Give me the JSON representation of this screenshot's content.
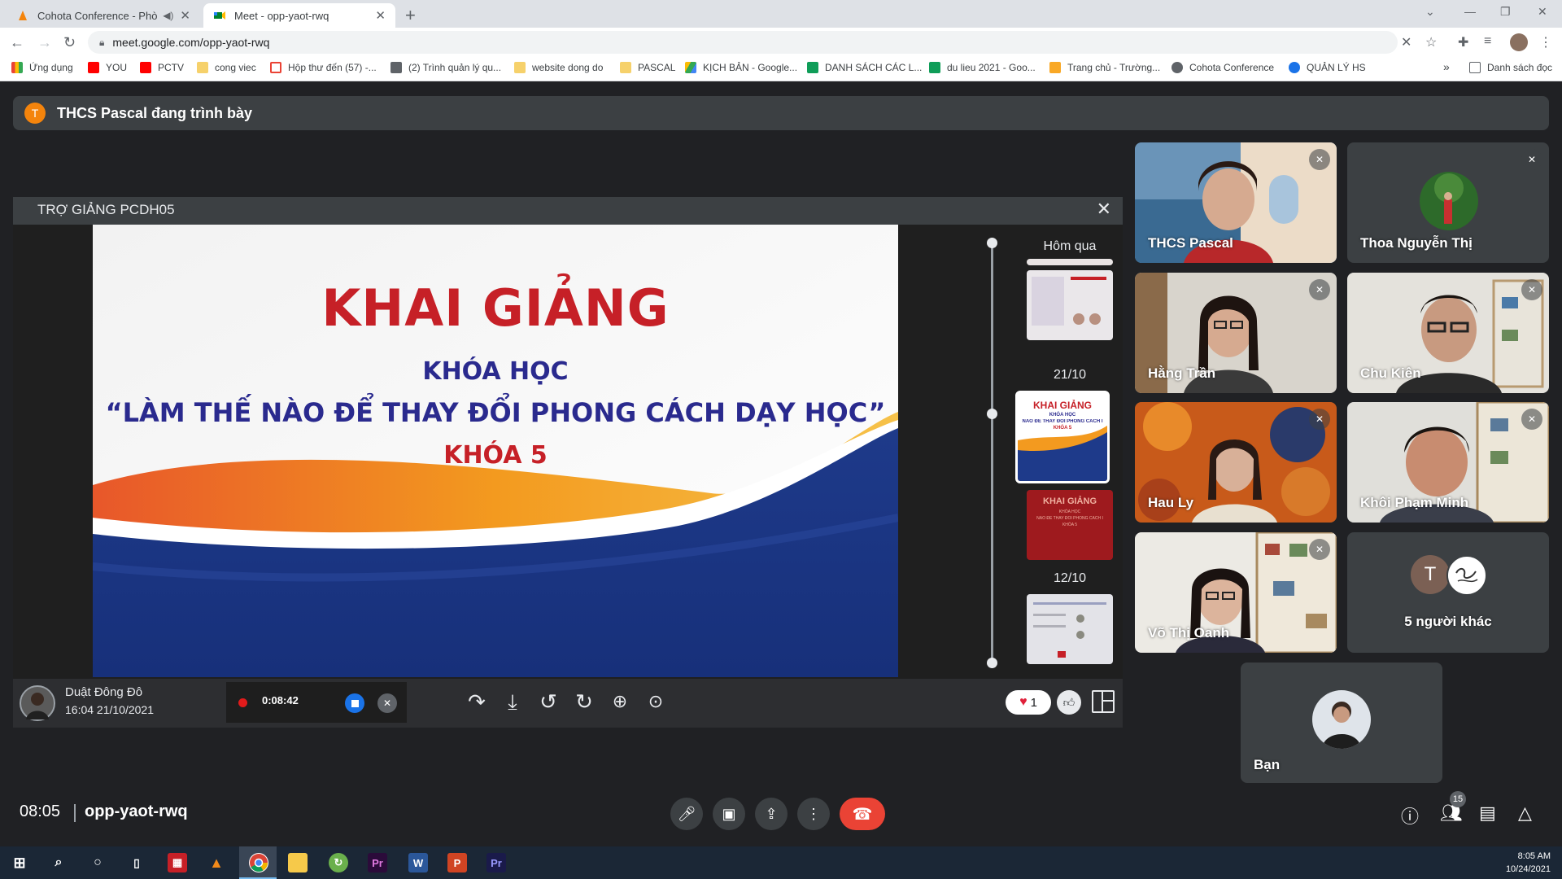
{
  "browser": {
    "tabs": [
      {
        "title": "Cohota Conference - Phòng",
        "active": false
      },
      {
        "title": "Meet - opp-yaot-rwq",
        "active": true
      }
    ],
    "url": "meet.google.com/opp-yaot-rwq",
    "bookmarks": [
      "Ứng dụng",
      "YOU",
      "PCTV",
      "cong viec",
      "Hộp thư đến (57) -...",
      "(2) Trình quản lý qu...",
      "website dong do",
      "PASCAL",
      "KỊCH BẢN - Google...",
      "DANH SÁCH CÁC L...",
      "du lieu 2021 - Goo...",
      "Trang chủ - Trường...",
      "Cohota Conference",
      "QUẢN LÝ HS"
    ],
    "more_bookmarks": "»",
    "other_bookmarks": "Danh sách đọc"
  },
  "meet": {
    "presenter_avatar": "T",
    "presenter_text": "THCS Pascal đang trình bày",
    "share_title": "TRỢ GIẢNG PCDH05",
    "slide": {
      "title": "KHAI GIẢNG",
      "line1": "KHÓA HỌC",
      "line2": "“LÀM THẾ NÀO ĐỂ THAY ĐỔI PHONG CÁCH DẠY HỌC”",
      "line3": "KHÓA 5"
    },
    "timeline": {
      "label_top": "Hôm qua",
      "labels": [
        "21/10",
        "12/10"
      ],
      "selected_thumb_title": "KHAI GIẢNG",
      "selected_thumb_sub": "KHÓA HỌC",
      "selected_thumb_line": "NÀO ĐỂ THAY ĐỔI PHONG CÁCH I",
      "selected_thumb_k": "KHÓA 5"
    },
    "share_bottom": {
      "user_name": "Duật Đông Đô",
      "timestamp": "16:04 21/10/2021",
      "rec_time": "0:08:42",
      "heart_count": "1"
    },
    "participants": [
      {
        "name": "THCS Pascal",
        "muted": true
      },
      {
        "name": "Thoa Nguyễn Thị",
        "muted": true
      },
      {
        "name": "Hằng Trần",
        "muted": true
      },
      {
        "name": "Chu Kiên",
        "muted": true
      },
      {
        "name": "Hau Ly",
        "muted": true
      },
      {
        "name": "Khôi Phạm Minh",
        "muted": true
      },
      {
        "name": "Võ Thị Oanh",
        "muted": true
      },
      {
        "name": "5 người khác",
        "avatar_letter": "T"
      },
      {
        "name": "Bạn"
      }
    ],
    "clock": "08:05",
    "meeting_code": "opp-yaot-rwq",
    "people_count": "15"
  },
  "taskbar": {
    "time": "8:05 AM",
    "date": "10/24/2021"
  },
  "colors": {
    "meet_bg": "#202124",
    "panel": "#3c4043",
    "end_call": "#ea4335",
    "slide_red": "#c62027",
    "slide_navy": "#2a2a8e"
  }
}
